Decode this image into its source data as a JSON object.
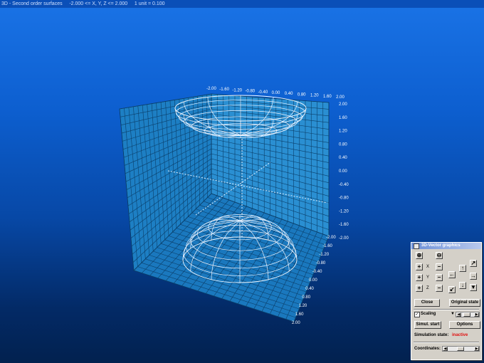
{
  "window": {
    "title": "3D - Second order surfaces     -2.000 <= X, Y, Z <= 2.000     1 unit = 0.100"
  },
  "axes": {
    "top_ticks": [
      "-2.00",
      "-1.60",
      "-1.20",
      "-0.80",
      "-0.40",
      "0.00",
      "0.40",
      "0.80",
      "1.20",
      "1.60",
      "2.00"
    ],
    "right_ticks": [
      "2.00",
      "1.60",
      "1.20",
      "0.80",
      "0.40",
      "0.00",
      "-0.40",
      "-0.80",
      "-1.20",
      "-1.60",
      "-2.00"
    ],
    "bottom_ticks": [
      "-2.00",
      "-1.60",
      "-1.20",
      "-0.80",
      "-0.40",
      "0.00",
      "0.40",
      "0.80",
      "1.20",
      "1.60",
      "2.00"
    ]
  },
  "panel": {
    "title": "3D-Vector graphics",
    "icons": {
      "zoom_in": "zoom-in-icon",
      "zoom_out": "zoom-out-icon",
      "rotate": "arrow-icons"
    },
    "axis_labels": [
      "X",
      "Y",
      "Z"
    ],
    "plus_label": "+",
    "minus_label": "−",
    "close_label": "Close",
    "original_label": "Original state",
    "scaling_label": "Scaling",
    "scaling_checked": "✓",
    "sim_start_label": "Simul. start",
    "options_label": "Options",
    "sim_state_label": "Simulation state:",
    "sim_state_value": "inactive",
    "coordinates_label": "Coordinates:",
    "arrows": {
      "up": "▲",
      "down": "▼",
      "left": "◀",
      "right": "▶",
      "upright": "↗",
      "downleft": "↙",
      "arr_left": "←",
      "arr_right": "→",
      "arr_up": "↑",
      "arr_down": "↓",
      "arr_ne": "↗",
      "arr_sw": "↙"
    },
    "accent_colors": {
      "state_inactive": "#e01010",
      "titlebar": "#6b8fd6"
    }
  }
}
